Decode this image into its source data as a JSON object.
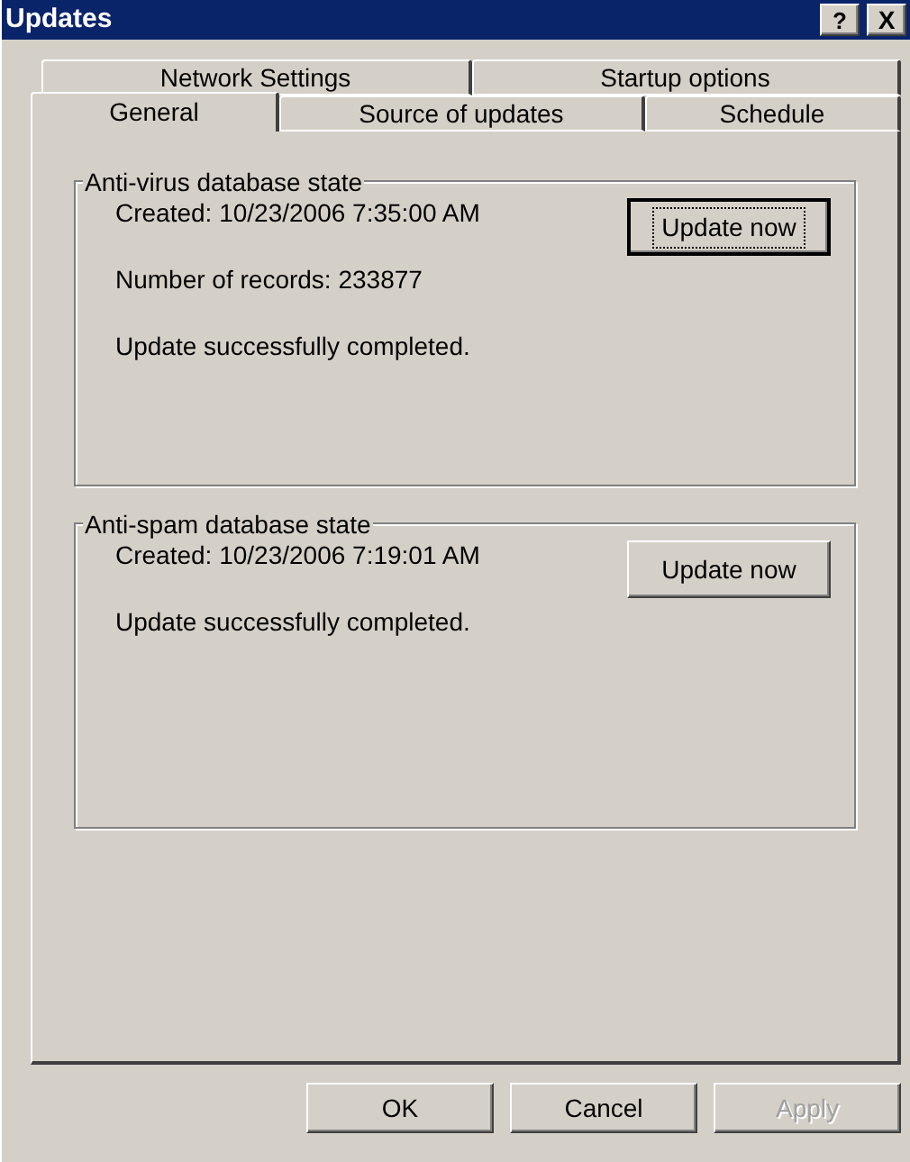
{
  "window": {
    "title": "Updates",
    "title_buttons": [
      {
        "kind": "help",
        "label": "?"
      },
      {
        "kind": "close",
        "label": "X"
      }
    ]
  },
  "tab_rows": [
    {
      "tabs": [
        {
          "label": "Network Settings",
          "selected": false
        },
        {
          "label": "Startup options",
          "selected": false
        }
      ]
    },
    {
      "tabs": [
        {
          "label": "General",
          "selected": true
        },
        {
          "label": "Source of updates",
          "selected": false
        },
        {
          "label": "Schedule",
          "selected": false
        }
      ]
    }
  ],
  "groups": [
    {
      "title": "Anti-virus database state",
      "lines": [
        "Created: 10/23/2006 7:35:00 AM",
        "Number of records: 233877",
        "Update successfully completed."
      ],
      "button": {
        "label": "Update now",
        "focused": true
      }
    },
    {
      "title": "Anti-spam database state",
      "lines": [
        "Created: 10/23/2006 7:19:01 AM",
        "Update successfully completed."
      ],
      "button": {
        "label": "Update now",
        "focused": false
      }
    }
  ],
  "buttons": [
    {
      "label": "OK",
      "disabled": false
    },
    {
      "label": "Cancel",
      "disabled": false
    },
    {
      "label": "Apply",
      "disabled": true
    }
  ]
}
